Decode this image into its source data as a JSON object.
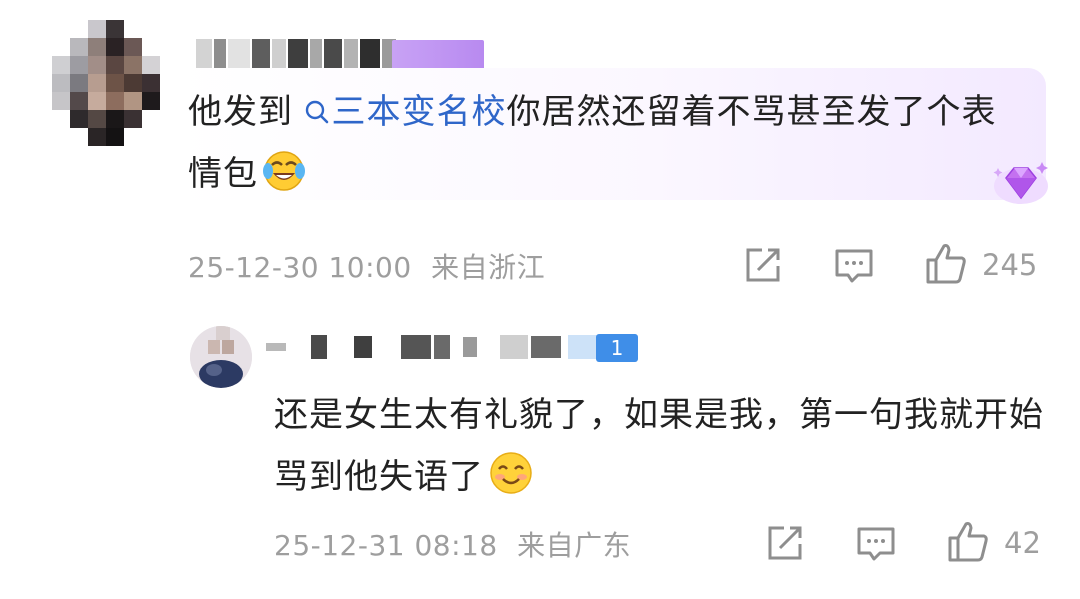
{
  "comments": [
    {
      "text_before": "他发到",
      "search_link": "三本变名校",
      "text_after": "你居然还留着不骂甚至发了个表情包",
      "emoji": "laughing-crying-emoji",
      "timestamp": "25-12-30 10:00",
      "location": "来自浙江",
      "likes": "245"
    },
    {
      "user_tag": "1",
      "text": "还是女生太有礼貌了，如果是我，第一句我就开始骂到他失语了",
      "emoji": "smile-emoji",
      "timestamp": "25-12-31 08:18",
      "location": "来自广东",
      "likes": "42"
    }
  ],
  "colors": {
    "link": "#2f66c9",
    "meta": "#9e9e9e",
    "text": "#222222",
    "vip_purple": "#b88af0"
  },
  "icons": [
    "share-icon",
    "comment-icon",
    "like-icon",
    "search-icon",
    "diamond-badge-icon"
  ]
}
